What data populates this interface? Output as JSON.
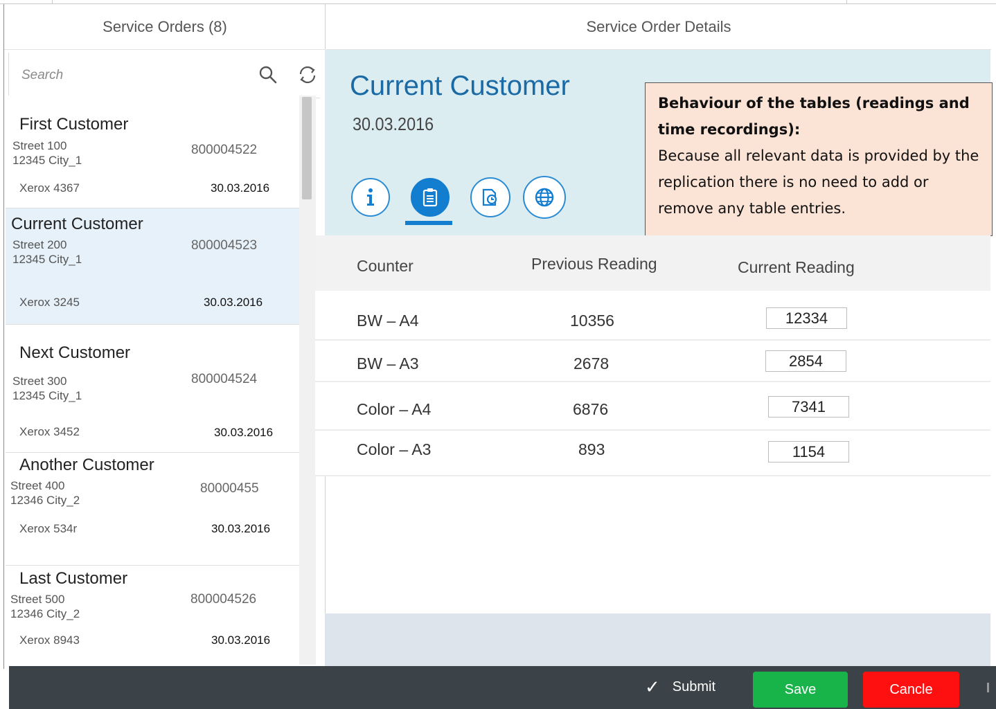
{
  "master": {
    "title": "Service Orders (8)",
    "search_placeholder": "Search",
    "items": [
      {
        "name": "First Customer",
        "street": "Street 100",
        "city": "12345 City_1",
        "number": "800004522",
        "device": "Xerox 4367",
        "date": "30.03.2016",
        "selected": false
      },
      {
        "name": "Current Customer",
        "street": "Street 200",
        "city": "12345 City_1",
        "number": "800004523",
        "device": "Xerox 3245",
        "date": "30.03.2016",
        "selected": true
      },
      {
        "name": "Next Customer",
        "street": "Street 300",
        "city": "12345 City_1",
        "number": "800004524",
        "device": "Xerox 3452",
        "date": "30.03.2016",
        "selected": false
      },
      {
        "name": "Another Customer",
        "street": "Street 400",
        "city": "12346 City_2",
        "number": "80000455",
        "device": "Xerox 534r",
        "date": "30.03.2016",
        "selected": false
      },
      {
        "name": "Last Customer",
        "street": "Street 500",
        "city": "12346 City_2",
        "number": "800004526",
        "device": "Xerox 8943",
        "date": "30.03.2016",
        "selected": false
      }
    ]
  },
  "detail": {
    "title": "Service Order Details",
    "customer": "Current Customer",
    "date": "30.03.2016",
    "tabs": [
      {
        "icon": "info-icon",
        "active": false
      },
      {
        "icon": "clipboard-icon",
        "active": true
      },
      {
        "icon": "document-clock-icon",
        "active": false
      },
      {
        "icon": "globe-icon",
        "active": false
      }
    ],
    "annotation": {
      "heading": "Behaviour of the tables (readings and time recordings):",
      "body": "Because all relevant data is provided by the replication there is no need to add or remove any table entries."
    },
    "table": {
      "headers": {
        "counter": "Counter",
        "previous": "Previous Reading",
        "current": "Current Reading"
      },
      "rows": [
        {
          "counter": "BW – A4",
          "previous": "10356",
          "current": "12334"
        },
        {
          "counter": "BW – A3",
          "previous": "2678",
          "current": "2854"
        },
        {
          "counter": "Color – A4",
          "previous": "6876",
          "current": "7341"
        },
        {
          "counter": "Color – A3",
          "previous": "893",
          "current": "1154"
        }
      ]
    }
  },
  "footer": {
    "submit": "Submit",
    "save": "Save",
    "cancel": "Cancle"
  },
  "colors": {
    "accent": "#137dcf",
    "selected_row": "#e6f1f9",
    "header_band": "#dcedf2",
    "annotation_bg": "#fbe3d6",
    "footer_bg": "#3c4348",
    "save": "#18b44a",
    "cancel": "#ff1010"
  }
}
